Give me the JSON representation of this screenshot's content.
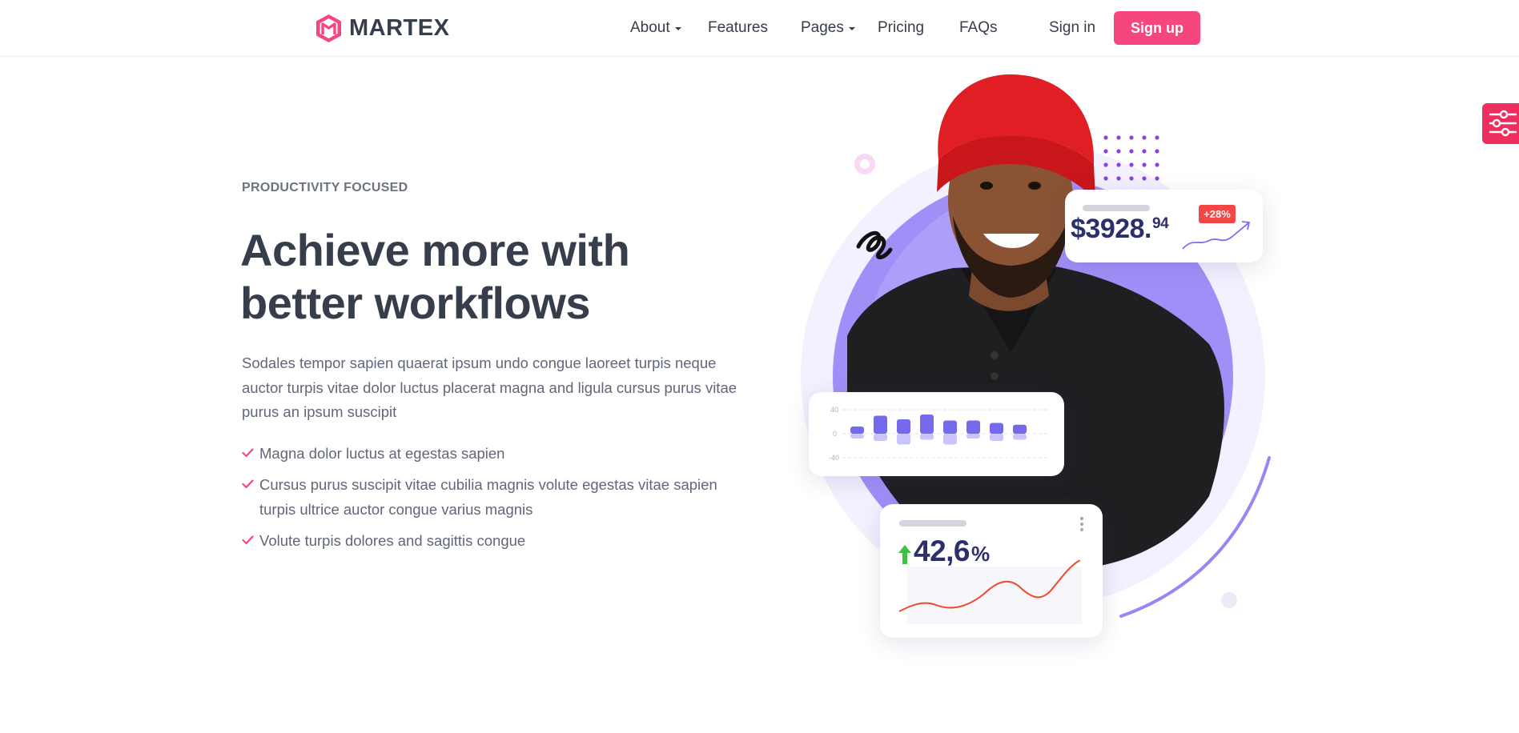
{
  "brand": {
    "name": "MARTEX",
    "accent": "#f7457d",
    "text_color": "#363d4b"
  },
  "nav": {
    "items": [
      {
        "label": "About",
        "has_dropdown": true
      },
      {
        "label": "Features",
        "has_dropdown": false
      },
      {
        "label": "Pages",
        "has_dropdown": true
      },
      {
        "label": "Pricing",
        "has_dropdown": false
      },
      {
        "label": "FAQs",
        "has_dropdown": false
      }
    ],
    "sign_in": "Sign in",
    "sign_up": "Sign up"
  },
  "settings_tab": {
    "icon": "sliders-icon",
    "color": "#ee2e5e"
  },
  "hero": {
    "eyebrow": "PRODUCTIVITY FOCUSED",
    "title_line1": "Achieve more with",
    "title_line2": "better workflows",
    "description": "Sodales tempor sapien quaerat ipsum undo congue laoreet turpis neque auctor turpis vitae dolor luctus placerat magna and ligula cursus purus vitae purus an ipsum suscipit",
    "features": [
      "Magna dolor luctus at egestas sapien",
      "Cursus purus suscipit vitae cubilia magnis volute egestas vitae sapien turpis ultrice auctor congue varius magnis",
      "Volute turpis dolores and sagittis congue"
    ]
  },
  "widgets": {
    "revenue": {
      "value": "$3928.",
      "cents": "94",
      "badge": "+28%"
    },
    "bar_chart": {
      "ticks": [
        "40",
        "0",
        "-40"
      ],
      "positive": [
        12,
        30,
        24,
        32,
        22,
        22,
        18,
        15
      ],
      "negative": [
        -8,
        -12,
        -18,
        -10,
        -18,
        -8,
        -12,
        -10
      ]
    },
    "growth": {
      "value": "42,6",
      "unit": "%",
      "arrow": "arrow-up-icon"
    }
  },
  "illustration": {
    "subject": "smiling man in red beanie and black polo shirt",
    "circle_color": "#a18ff7",
    "halo_color": "#f3f0ff"
  }
}
